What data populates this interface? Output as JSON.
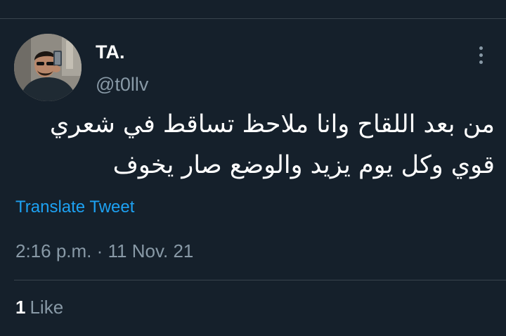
{
  "tweet": {
    "author": {
      "display_name": "TA.",
      "handle": "@t0llv"
    },
    "text_lines": [
      "من بعد اللقاح وانا ملاحظ تساقط في شعري",
      "قوي وكل يوم يزيد والوضع صار يخوف"
    ],
    "translate_label": "Translate Tweet",
    "timestamp": "2:16 p.m. · 11 Nov. 21",
    "likes": {
      "count": "1",
      "label": "Like"
    },
    "more_icon": "more-vertical-icon"
  },
  "colors": {
    "background": "#15202b",
    "text_primary": "#ffffff",
    "text_secondary": "#8899a6",
    "accent": "#1da1f2",
    "divider": "#38444d"
  }
}
